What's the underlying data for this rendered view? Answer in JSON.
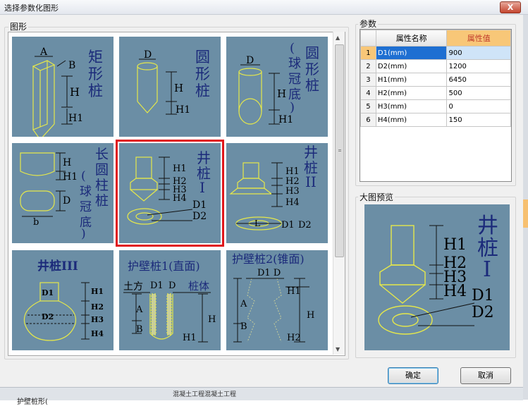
{
  "window": {
    "title": "选择参数化图形",
    "close_label": "X"
  },
  "groups": {
    "shapes_label": "图形",
    "params_label": "参数",
    "preview_label": "大图预览"
  },
  "tiles": [
    {
      "name": "矩形桩",
      "labels": {
        "a": "A",
        "b": "B",
        "h": "H",
        "h1": "H1"
      }
    },
    {
      "name": "圆形桩",
      "labels": {
        "d": "D",
        "h": "H",
        "h1": "H1"
      }
    },
    {
      "name": "圆形(球冠底)",
      "labels": {
        "d": "D",
        "h": "H",
        "h1": "H1"
      }
    },
    {
      "name": "长圆柱桩(球冠底)",
      "labels": {
        "h": "H",
        "h1": "H1",
        "d": "D",
        "b": "b"
      }
    },
    {
      "name": "井桩I",
      "labels": {
        "h1": "H1",
        "h2": "H2",
        "h3": "H3",
        "h4": "H4",
        "d1": "D1",
        "d2": "D2"
      }
    },
    {
      "name": "井桩II",
      "labels": {
        "h1": "H1",
        "h2": "H2",
        "h3": "H3",
        "h4": "H4",
        "l": "L",
        "d1": "D1",
        "d2": "D2"
      }
    },
    {
      "name": "井桩III",
      "labels": {
        "d1": "D1",
        "d2": "D2",
        "h1": "H1",
        "h2": "H2",
        "h3": "H3",
        "h4": "H4"
      }
    },
    {
      "name": "护壁桩1(直面)",
      "labels": {
        "tufang": "土方",
        "d1": "D1",
        "d": "D",
        "zhuti": "桩体",
        "a": "A",
        "b": "B",
        "h": "H",
        "h1": "H1"
      }
    },
    {
      "name": "护壁桩2(锥面)",
      "labels": {
        "d1d": "D1 D",
        "h1": "H1",
        "a": "A",
        "b": "B",
        "h": "H",
        "h2": "H2"
      }
    }
  ],
  "params": {
    "col_index": "",
    "col_name": "属性名称",
    "col_value": "属性值",
    "rows": [
      {
        "index": "1",
        "name": "D1(mm)",
        "value": "900"
      },
      {
        "index": "2",
        "name": "D2(mm)",
        "value": "1200"
      },
      {
        "index": "3",
        "name": "H1(mm)",
        "value": "6450"
      },
      {
        "index": "4",
        "name": "H2(mm)",
        "value": "500"
      },
      {
        "index": "5",
        "name": "H3(mm)",
        "value": "0"
      },
      {
        "index": "6",
        "name": "H4(mm)",
        "value": "150"
      }
    ]
  },
  "preview": {
    "name": "井桩I",
    "labels": {
      "h1": "H1",
      "h2": "H2",
      "h3": "H3",
      "h4": "H4",
      "d1": "D1",
      "d2": "D2"
    }
  },
  "buttons": {
    "ok": "确定",
    "cancel": "取消"
  },
  "background": {
    "left_text": "护壁桩形(",
    "tree_text": "混凝土工程混凝土工程"
  },
  "colors": {
    "tile_bg": "#6b8ea5",
    "line": "#e6e84a",
    "text": "#1b2a7a",
    "selection": "#e0161b",
    "header_value": "#f8c778"
  }
}
